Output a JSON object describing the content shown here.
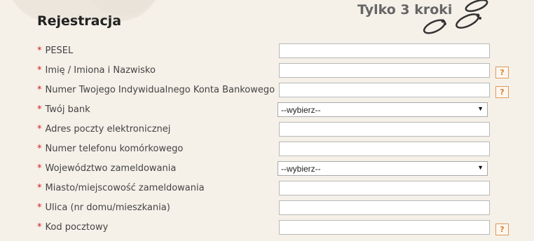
{
  "header": {
    "title": "Rejestracja",
    "steps_label": "Tylko 3 kroki"
  },
  "form": {
    "required_mark": "*",
    "help_label": "?",
    "fields": [
      {
        "label": "PESEL",
        "value": "",
        "type": "text"
      },
      {
        "label": "Imię / Imiona i Nazwisko",
        "value": "",
        "type": "text",
        "help": true
      },
      {
        "label": "Numer Twojego Indywidualnego Konta Bankowego",
        "value": "",
        "type": "text",
        "help": true
      },
      {
        "label": "Twój bank",
        "value": "--wybierz--",
        "type": "select"
      },
      {
        "label": "Adres poczty elektronicznej",
        "value": "",
        "type": "text"
      },
      {
        "label": "Numer telefonu komórkowego",
        "value": "",
        "type": "text"
      },
      {
        "label": "Województwo zameldowania",
        "value": "--wybierz--",
        "type": "select"
      },
      {
        "label": "Miasto/miejscowość zameldowania",
        "value": "",
        "type": "text"
      },
      {
        "label": "Ulica (nr domu/mieszkania)",
        "value": "",
        "type": "text"
      },
      {
        "label": "Kod pocztowy",
        "value": "",
        "type": "text",
        "help": true
      }
    ]
  },
  "colors": {
    "required": "#d21d1d",
    "help_border": "#e09a55",
    "background": "#f5f0e8"
  },
  "icons": {
    "steps": "footprints-icon",
    "select_arrow": "triangle-down-icon",
    "help": "question-mark-icon"
  }
}
